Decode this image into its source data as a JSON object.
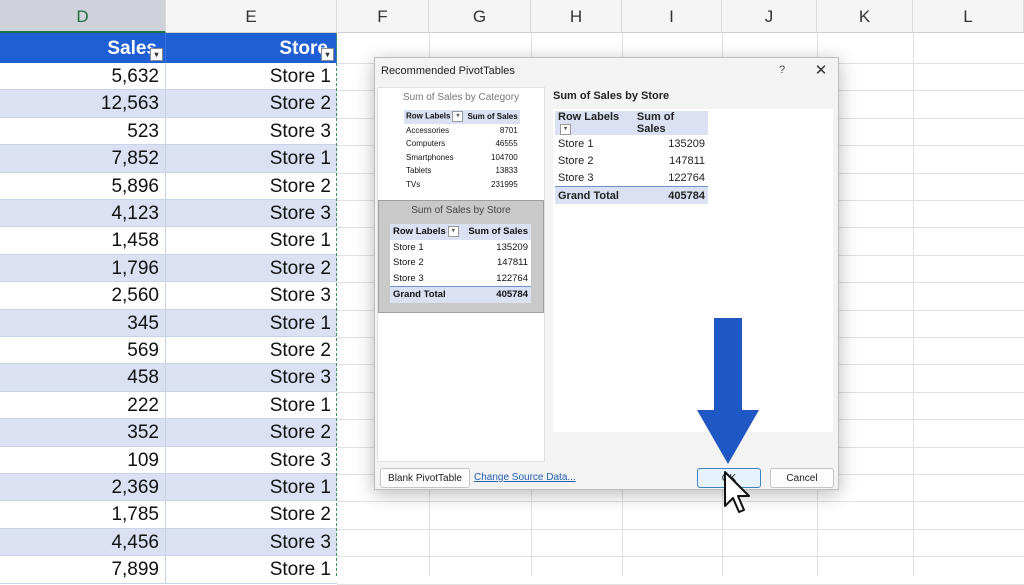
{
  "columns": [
    {
      "letter": "D",
      "selected": true
    },
    {
      "letter": "E",
      "selected": false
    },
    {
      "letter": "F",
      "selected": false
    },
    {
      "letter": "G",
      "selected": false
    },
    {
      "letter": "H",
      "selected": false
    },
    {
      "letter": "I",
      "selected": false
    },
    {
      "letter": "J",
      "selected": false
    },
    {
      "letter": "K",
      "selected": false
    },
    {
      "letter": "L",
      "selected": false
    }
  ],
  "table": {
    "headers": [
      "Sales",
      "Store"
    ],
    "rows": [
      [
        "5,632",
        "Store 1"
      ],
      [
        "12,563",
        "Store 2"
      ],
      [
        "523",
        "Store 3"
      ],
      [
        "7,852",
        "Store 1"
      ],
      [
        "5,896",
        "Store 2"
      ],
      [
        "4,123",
        "Store 3"
      ],
      [
        "1,458",
        "Store 1"
      ],
      [
        "1,796",
        "Store 2"
      ],
      [
        "2,560",
        "Store 3"
      ],
      [
        "345",
        "Store 1"
      ],
      [
        "569",
        "Store 2"
      ],
      [
        "458",
        "Store 3"
      ],
      [
        "222",
        "Store 1"
      ],
      [
        "352",
        "Store 2"
      ],
      [
        "109",
        "Store 3"
      ],
      [
        "2,369",
        "Store 1"
      ],
      [
        "1,785",
        "Store 2"
      ],
      [
        "4,456",
        "Store 3"
      ],
      [
        "7,899",
        "Store 1"
      ]
    ]
  },
  "dialog": {
    "title": "Recommended PivotTables",
    "help": "?",
    "close": "✕",
    "options": [
      {
        "title": "Sum of Sales by Category",
        "headers": [
          "Row Labels",
          "Sum of Sales"
        ],
        "rows": [
          [
            "Accessories",
            "8701"
          ],
          [
            "Computers",
            "46555"
          ],
          [
            "Smartphones",
            "104700"
          ],
          [
            "Tablets",
            "13833"
          ],
          [
            "TVs",
            "231995"
          ]
        ]
      },
      {
        "title": "Sum of Sales by Store",
        "headers": [
          "Row Labels",
          "Sum of Sales"
        ],
        "rows": [
          [
            "Store 1",
            "135209"
          ],
          [
            "Store 2",
            "147811"
          ],
          [
            "Store 3",
            "122764"
          ]
        ],
        "total": [
          "Grand Total",
          "405784"
        ]
      }
    ],
    "preview": {
      "title": "Sum of Sales by Store",
      "headers": [
        "Row Labels",
        "Sum of Sales"
      ],
      "rows": [
        [
          "Store 1",
          "135209"
        ],
        [
          "Store 2",
          "147811"
        ],
        [
          "Store 3",
          "122764"
        ]
      ],
      "total": [
        "Grand Total",
        "405784"
      ]
    },
    "buttons": {
      "blank": "Blank PivotTable",
      "change_source": "Change Source Data...",
      "ok": "OK",
      "cancel": "Cancel"
    }
  },
  "colors": {
    "table_header": "#1f5fd6",
    "band": "#d9e1f2",
    "arrow": "#1f58c4"
  }
}
